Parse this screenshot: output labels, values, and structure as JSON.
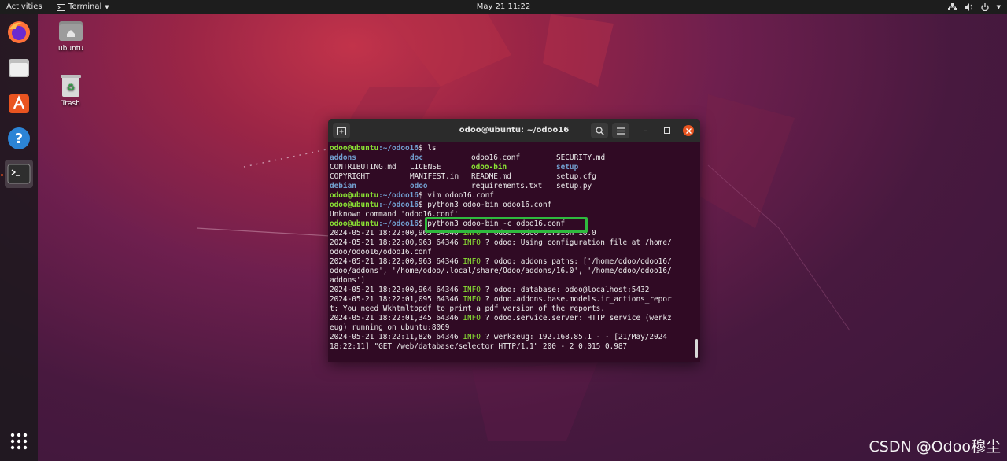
{
  "topbar": {
    "activities": "Activities",
    "app_menu": "Terminal",
    "clock": "May 21  11:22"
  },
  "desktop": {
    "home_label": "ubuntu",
    "trash_label": "Trash"
  },
  "terminal": {
    "title": "odoo@ubuntu: ~/odoo16",
    "prompt_user": "odoo@ubuntu",
    "prompt_path": ":~/odoo16",
    "prompt_symbol": "$ ",
    "cmd1": "ls",
    "ls_rows": [
      [
        {
          "t": "addons",
          "c": "dir"
        },
        {
          "t": "doc",
          "c": "dir"
        },
        {
          "t": "odoo16.conf",
          "c": ""
        },
        {
          "t": "SECURITY.md",
          "c": ""
        }
      ],
      [
        {
          "t": "CONTRIBUTING.md",
          "c": ""
        },
        {
          "t": "LICENSE",
          "c": ""
        },
        {
          "t": "odoo-bin",
          "c": "exe"
        },
        {
          "t": "setup",
          "c": "dir"
        }
      ],
      [
        {
          "t": "COPYRIGHT",
          "c": ""
        },
        {
          "t": "MANIFEST.in",
          "c": ""
        },
        {
          "t": "README.md",
          "c": ""
        },
        {
          "t": "setup.cfg",
          "c": ""
        }
      ],
      [
        {
          "t": "debian",
          "c": "dir"
        },
        {
          "t": "odoo",
          "c": "dir"
        },
        {
          "t": "requirements.txt",
          "c": ""
        },
        {
          "t": "setup.py",
          "c": ""
        }
      ]
    ],
    "cmd2": "vim odoo16.conf",
    "cmd3": "python3 odoo-bin odoo16.conf",
    "error_line": "Unknown command 'odoo16.conf'",
    "cmd4": "python3 odoo-bin -c odoo16.conf",
    "info_tag": "INFO",
    "logs": [
      {
        "pre": "2024-05-21 18:22:00,963 64346 ",
        "post": " ? odoo: Odoo version 16.0",
        "cont": []
      },
      {
        "pre": "2024-05-21 18:22:00,963 64346 ",
        "post": " ? odoo: Using configuration file at /home/",
        "cont": [
          "odoo/odoo16/odoo16.conf"
        ]
      },
      {
        "pre": "2024-05-21 18:22:00,963 64346 ",
        "post": " ? odoo: addons paths: ['/home/odoo/odoo16/",
        "cont": [
          "odoo/addons', '/home/odoo/.local/share/Odoo/addons/16.0', '/home/odoo/odoo16/",
          "addons']"
        ]
      },
      {
        "pre": "2024-05-21 18:22:00,964 64346 ",
        "post": " ? odoo: database: odoo@localhost:5432",
        "cont": []
      },
      {
        "pre": "2024-05-21 18:22:01,095 64346 ",
        "post": " ? odoo.addons.base.models.ir_actions_repor",
        "cont": [
          "t: You need Wkhtmltopdf to print a pdf version of the reports."
        ]
      },
      {
        "pre": "2024-05-21 18:22:01,345 64346 ",
        "post": " ? odoo.service.server: HTTP service (werkz",
        "cont": [
          "eug) running on ubuntu:8069"
        ]
      },
      {
        "pre": "2024-05-21 18:22:11,826 64346 ",
        "post": " ? werkzeug: 192.168.85.1 - - [21/May/2024",
        "cont": [
          "18:22:11] \"GET /web/database/selector HTTP/1.1\" 200 - 2 0.015 0.987"
        ]
      }
    ]
  },
  "watermark": "CSDN @Odoo穆尘",
  "colors": {
    "terminal_bg": "#300a24",
    "prompt_green": "#8ae234",
    "dir_blue": "#729fcf",
    "highlight_box": "#2fba3e",
    "ubuntu_orange": "#e95420"
  },
  "icons": [
    "network-icon",
    "volume-icon",
    "power-icon",
    "firefox-icon",
    "files-icon",
    "software-center-icon",
    "help-icon",
    "terminal-icon",
    "app-grid-icon",
    "home-folder-icon",
    "trash-icon",
    "new-tab-icon",
    "search-icon",
    "menu-icon",
    "minimize-icon",
    "maximize-icon",
    "close-icon"
  ]
}
